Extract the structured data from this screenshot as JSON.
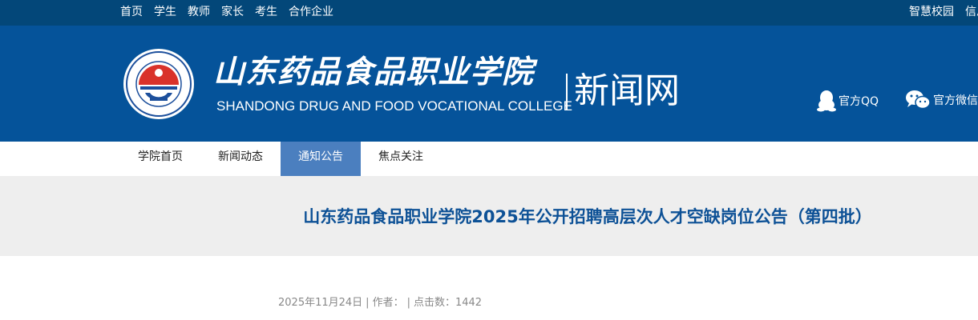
{
  "topbar": {
    "left_links": [
      "首页",
      "学生",
      "教师",
      "家长",
      "考生",
      "合作企业"
    ],
    "right_links": [
      "智慧校园",
      "信息公开"
    ]
  },
  "header": {
    "school_name_cn": "山东药品食品职业学院",
    "school_name_en": "SHANDONG DRUG AND FOOD VOCATIONAL COLLEGE",
    "site_name": "新闻网",
    "qq_label": "官方QQ",
    "wechat_label": "官方微信",
    "brand_color": "#05539a",
    "topbar_color": "#034779"
  },
  "nav": {
    "items": [
      "学院首页",
      "新闻动态",
      "通知公告",
      "焦点关注"
    ],
    "active": "通知公告",
    "active_color": "#4b7fbf"
  },
  "article": {
    "title": "山东药品食品职业学院2025年公开招聘高层次人才空缺岗位公告（第四批）",
    "date": "2025年11月24日",
    "author_label": "作者：",
    "author": "",
    "views_label": "点击数：",
    "views": "1442",
    "title_color": "#0d5196"
  }
}
